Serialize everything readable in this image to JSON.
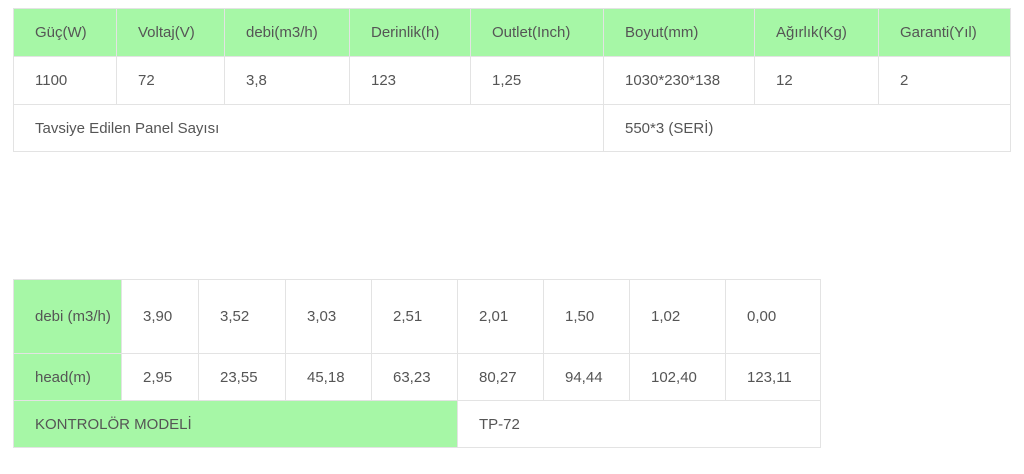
{
  "spec": {
    "headers": [
      "Güç(W)",
      "Voltaj(V)",
      "debi(m3/h)",
      "Derinlik(h)",
      "Outlet(Inch)",
      "Boyut(mm)",
      "Ağırlık(Kg)",
      "Garanti(Yıl)"
    ],
    "values": [
      "1100",
      "72",
      "3,8",
      "123",
      "1,25",
      "1030*230*138",
      "12",
      "2"
    ],
    "panel_label": "Tavsiye Edilen Panel Sayısı",
    "panel_value": "550*3 (SERİ)"
  },
  "curve": {
    "debi_label": "debi (m3/h)",
    "debi_values": [
      "3,90",
      "3,52",
      "3,03",
      "2,51",
      "2,01",
      "1,50",
      "1,02",
      "0,00"
    ],
    "head_label": "head(m)",
    "head_values": [
      "2,95",
      "23,55",
      "45,18",
      "63,23",
      "80,27",
      "94,44",
      "102,40",
      "123,11"
    ],
    "controller_label": "KONTROLÖR MODELİ",
    "controller_value": "TP-72"
  },
  "colors": {
    "header_bg": "#a6f7a6",
    "border": "#e3e3e3",
    "text": "#555555"
  }
}
